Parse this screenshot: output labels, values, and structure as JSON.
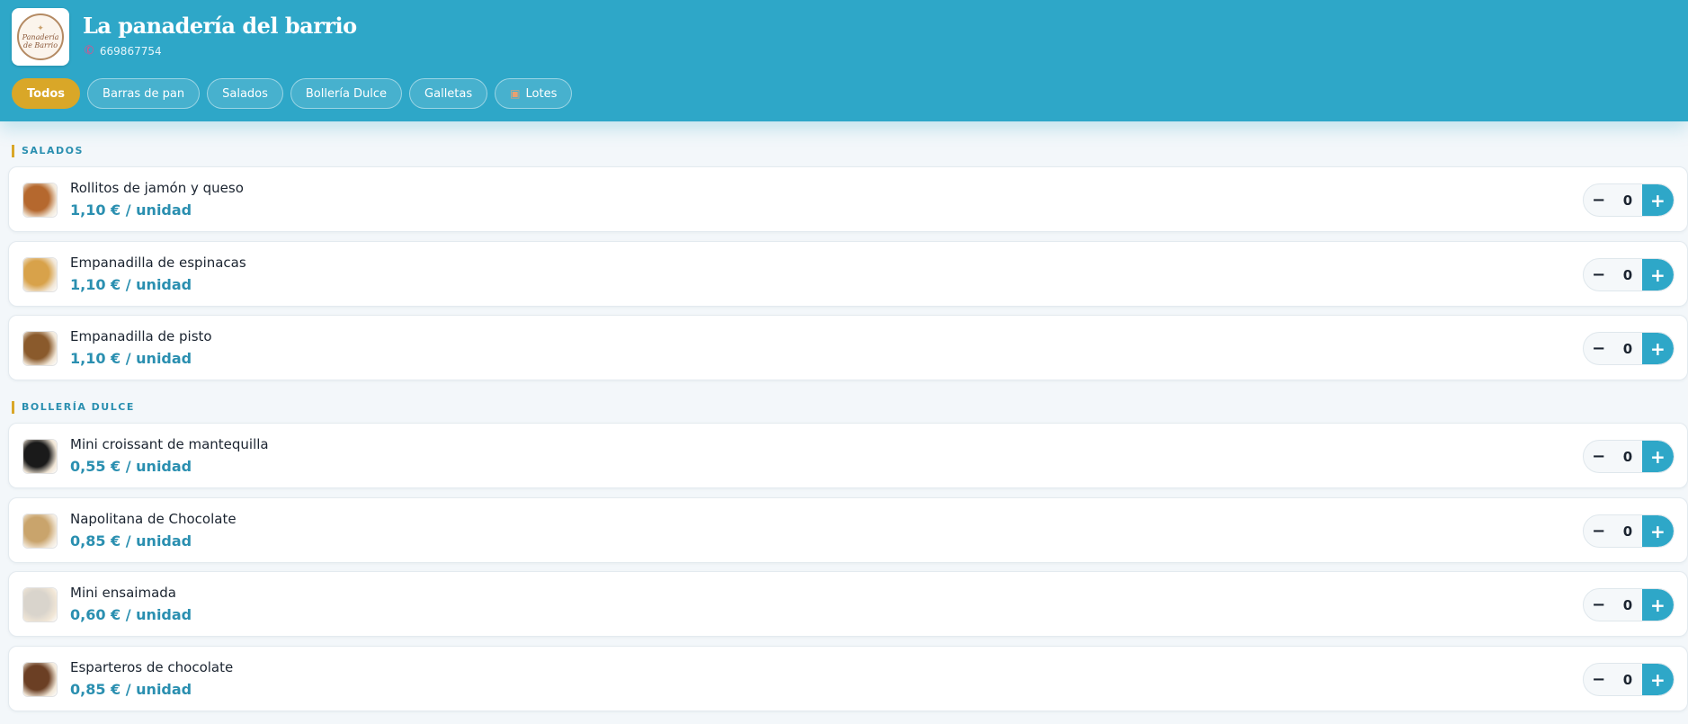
{
  "shop": {
    "name": "La panadería del barrio",
    "phone": "669867754",
    "logo_text_1": "Panadería",
    "logo_text_2": "de Barrio"
  },
  "tabs": [
    {
      "label": "Todos",
      "active": true
    },
    {
      "label": "Barras de pan",
      "active": false
    },
    {
      "label": "Salados",
      "active": false
    },
    {
      "label": "Bollería Dulce",
      "active": false
    },
    {
      "label": "Galletas",
      "active": false
    },
    {
      "label": "Lotes",
      "active": false,
      "icon": "box-icon"
    }
  ],
  "sections": [
    {
      "title": "SALADOS",
      "products": [
        {
          "name": "Rollitos de jamón y queso",
          "price": "1,10 € / unidad",
          "qty": "0",
          "thumb_color": "#b5682e"
        },
        {
          "name": "Empanadilla de espinacas",
          "price": "1,10 € / unidad",
          "qty": "0",
          "thumb_color": "#d8a24a"
        },
        {
          "name": "Empanadilla de pisto",
          "price": "1,10 € / unidad",
          "qty": "0",
          "thumb_color": "#8a5a2c"
        }
      ]
    },
    {
      "title": "BOLLERÍA DULCE",
      "products": [
        {
          "name": "Mini croissant de mantequilla",
          "price": "0,55 € / unidad",
          "qty": "0",
          "thumb_color": "#1a1a1a"
        },
        {
          "name": "Napolitana de Chocolate",
          "price": "0,85 € / unidad",
          "qty": "0",
          "thumb_color": "#c9a46c"
        },
        {
          "name": "Mini ensaimada",
          "price": "0,60 € / unidad",
          "qty": "0",
          "thumb_color": "#d9d4cc"
        },
        {
          "name": "Esparteros de chocolate",
          "price": "0,85 € / unidad",
          "qty": "0",
          "thumb_color": "#6b3f24"
        }
      ]
    }
  ],
  "stepper": {
    "minus": "−",
    "plus": "+"
  },
  "colors": {
    "header": "#2ea7c8",
    "accent": "#d9a728",
    "price": "#2a8fb0"
  }
}
